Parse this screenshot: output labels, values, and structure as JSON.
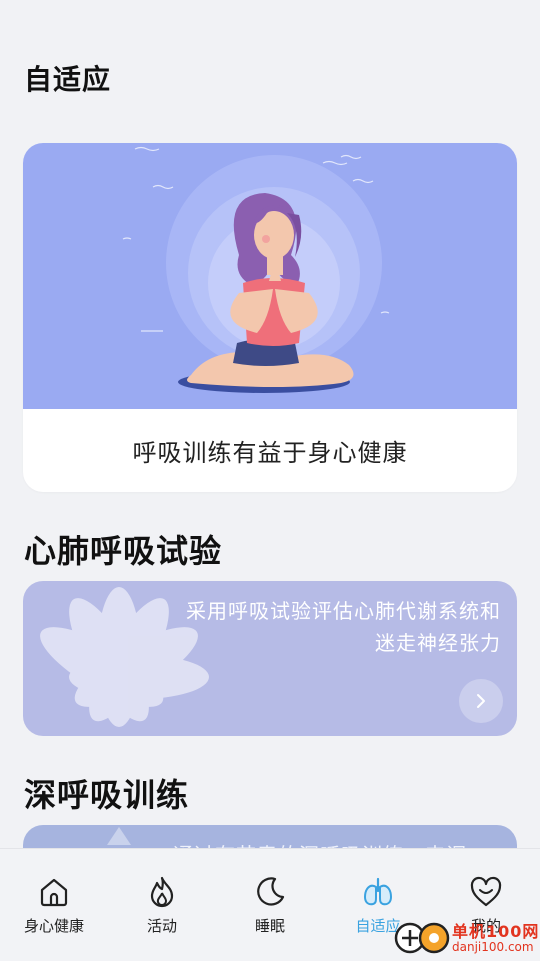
{
  "page": {
    "title": "自适应"
  },
  "hero_card": {
    "caption": "呼吸训练有益于身心健康"
  },
  "cardio_section": {
    "title": "心肺呼吸试验",
    "desc_line1": "采用呼吸试验评估心肺代谢系统和",
    "desc_line2": "迷走神经张力"
  },
  "deep_breath_section": {
    "title": "深呼吸训练",
    "desc_partial": "通过有节奏的深呼吸训练，来调"
  },
  "tabbar": {
    "items": [
      {
        "label": "身心健康",
        "icon": "house-icon"
      },
      {
        "label": "活动",
        "icon": "flame-icon"
      },
      {
        "label": "睡眠",
        "icon": "moon-icon"
      },
      {
        "label": "自适应",
        "icon": "lungs-icon",
        "active": true
      },
      {
        "label": "我的",
        "icon": "smile-heart-icon"
      }
    ]
  },
  "watermark": {
    "line1": "单机100网",
    "line2": "danji100.com"
  },
  "colors": {
    "background": "#f1f2f5",
    "hero_bg": "#9aaaf2",
    "cardio_bg": "#b6bbe6",
    "active_tab": "#3aa2e0"
  }
}
